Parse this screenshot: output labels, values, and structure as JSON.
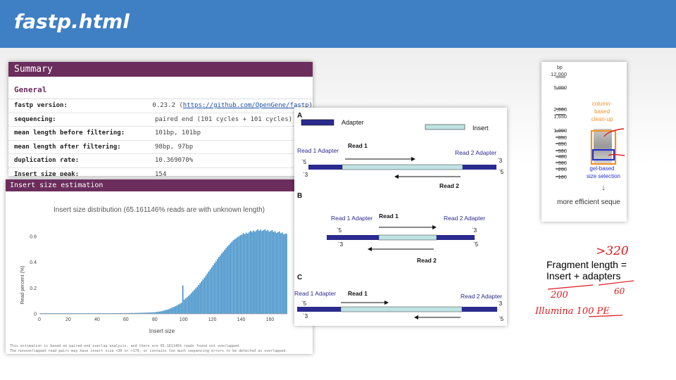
{
  "header": {
    "title": "fastp.html"
  },
  "summary": {
    "heading": "Summary",
    "general_heading": "General",
    "rows": [
      {
        "key": "fastp version:",
        "value": "0.23.2 (",
        "link": "https://github.com/OpenGene/fastp",
        "tail": ")"
      },
      {
        "key": "sequencing:",
        "value": "paired end (101 cycles + 101 cycles)"
      },
      {
        "key": "mean length before filtering:",
        "value": "101bp, 101bp"
      },
      {
        "key": "mean length after filtering:",
        "value": "98bp, 97bp"
      },
      {
        "key": "duplication rate:",
        "value": "10.369070%"
      },
      {
        "key": "Insert size peak:",
        "value": "154"
      }
    ]
  },
  "insert": {
    "heading": "Insert size estimation",
    "plot_title": "Insert size distribution (65.161146% reads are with unknown length)",
    "note1": "This estimation is based on paired-end overlap analysis, and there are 65.161146% reads found not overlapped.",
    "note2": "The nonoverlapped read pairs may have insert size <30 or >170, or contains too much sequencing errors to be detected as overlapped."
  },
  "chart_data": {
    "type": "bar",
    "xlabel": "Insert size",
    "ylabel": "Read percent (%)",
    "xlim": [
      0,
      172
    ],
    "ylim": [
      0,
      0.66
    ],
    "xticks": [
      "0",
      "20",
      "40",
      "60",
      "80",
      "100",
      "120",
      "140",
      "160"
    ],
    "yticks": [
      "0",
      "0.2",
      "0.4",
      "0.6"
    ],
    "x": [
      30,
      40,
      50,
      60,
      70,
      80,
      85,
      90,
      95,
      99,
      100,
      101,
      102,
      105,
      110,
      115,
      120,
      125,
      130,
      135,
      140,
      145,
      150,
      155,
      160,
      165,
      170,
      172
    ],
    "values": [
      0.005,
      0.005,
      0.005,
      0.006,
      0.008,
      0.012,
      0.02,
      0.035,
      0.06,
      0.085,
      0.22,
      0.11,
      0.12,
      0.15,
      0.21,
      0.28,
      0.36,
      0.44,
      0.51,
      0.57,
      0.61,
      0.63,
      0.645,
      0.65,
      0.645,
      0.635,
      0.625,
      0.62
    ],
    "bar_color": "#3f8fc9"
  },
  "diagram": {
    "adapter_legend": "Adapter",
    "insert_legend": "Insert",
    "panels": [
      {
        "id": "A",
        "left_label": "Read 1 Adapter",
        "right_label": "Read 2 Adapter",
        "read1": "Read 1",
        "read2": "Read 2"
      },
      {
        "id": "B",
        "left_label": "Read 1 Adapter",
        "right_label": "Read 2 Adapter",
        "read1": "Read 1",
        "read2": "Read 2"
      },
      {
        "id": "C",
        "left_label": "Read 1 Adapter",
        "right_label": "Read 2 Adapter",
        "read1": "Read 1"
      }
    ],
    "end5": "5",
    "end3": "3",
    "end5t": "5",
    "end3t": "3"
  },
  "gel": {
    "unit": "bp",
    "ladder": [
      "12,000",
      "5,000",
      "2,000",
      "1,650",
      "1,000",
      "850",
      "650",
      "500",
      "400",
      "300",
      "200",
      "100"
    ],
    "column_label": [
      "column-",
      "based",
      "clean-up"
    ],
    "gel_label": [
      "gel-based",
      "size selection"
    ],
    "arrow": "↓",
    "caption": "more efficient seque",
    "orange": "#f0922b",
    "blue": "#2233cc"
  },
  "notes": {
    "line1": "Fragment  length  =",
    "line2": "Insert + adapters",
    "hw_top": ">320",
    "hw_insert": "200",
    "hw_adapters": "60",
    "hw_bottom": "Illumina 100 PE"
  }
}
